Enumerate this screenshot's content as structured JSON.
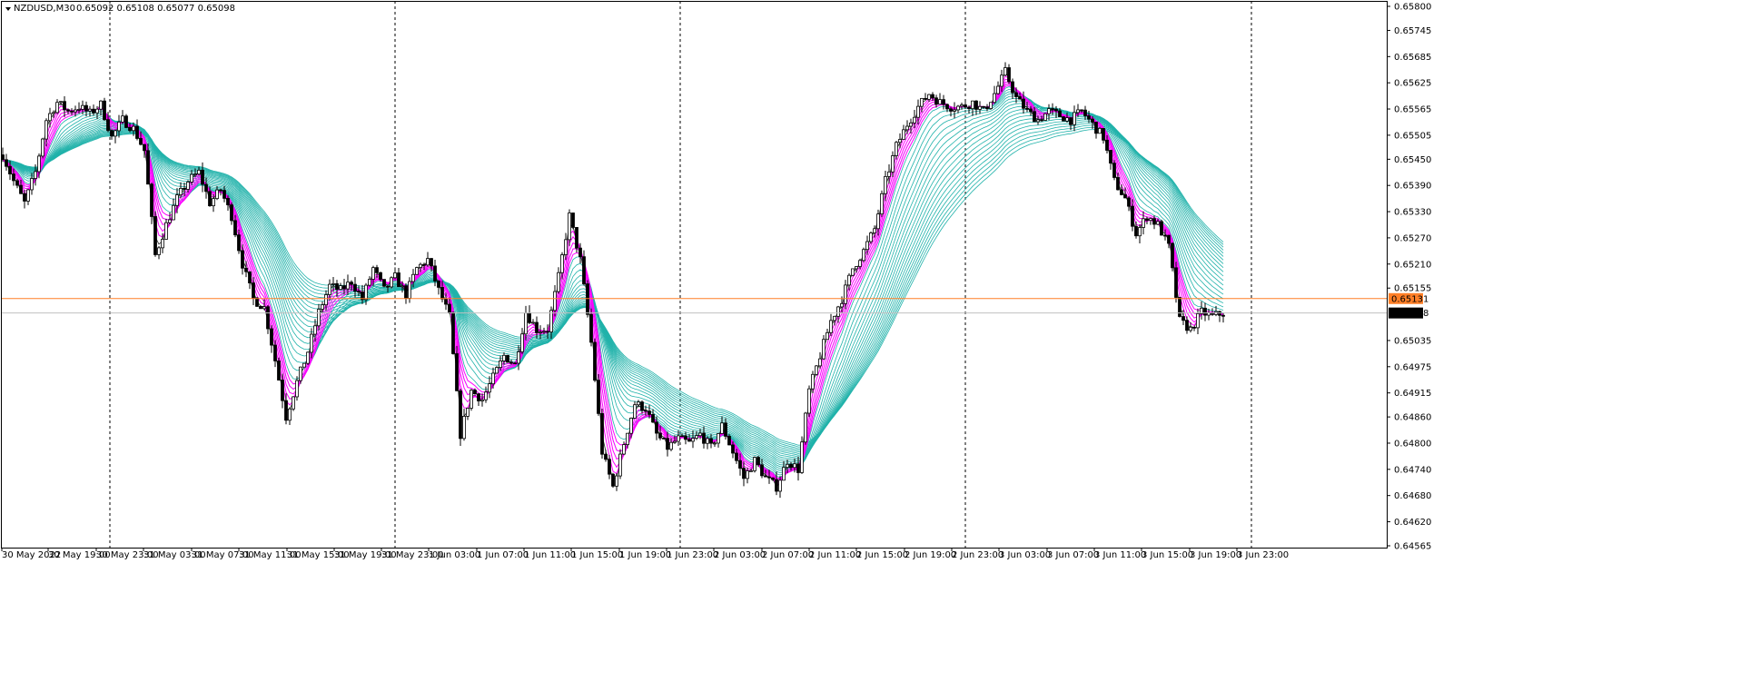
{
  "header": {
    "symbol": "NZDUSD,M30",
    "ohlc": "0.65092 0.65108 0.65077 0.65098",
    "menu_icon": "triangle-down-icon"
  },
  "colors": {
    "background": "#ffffff",
    "frame": "#000000",
    "candle_bull": "#ffffff",
    "candle_bear": "#000000",
    "candle_outline": "#000000",
    "ribbon_slow": "#20b2aa",
    "ribbon_fast": "#ff00ff",
    "line_fast_dark": "#222222",
    "price_line": "#ff7f27",
    "bid_line": "#c0c0c0",
    "separator": "#000000"
  },
  "chart_data": {
    "type": "candlestick",
    "symbol": "NZDUSD",
    "timeframe": "M30",
    "current_bid": 0.65098,
    "marked_level": 0.65131,
    "ylim": [
      0.64565,
      0.658
    ],
    "y_ticks": [
      "0.65800",
      "0.65745",
      "0.65685",
      "0.65625",
      "0.65565",
      "0.65505",
      "0.65450",
      "0.65390",
      "0.65330",
      "0.65270",
      "0.65210",
      "0.65155",
      "0.65131",
      "0.65098",
      "0.65035",
      "0.64975",
      "0.64915",
      "0.64860",
      "0.64800",
      "0.64740",
      "0.64680",
      "0.64620",
      "0.64565"
    ],
    "x_ticks": [
      "30 May 2022",
      "30 May 19:00",
      "30 May 23:00",
      "31 May 03:00",
      "31 May 07:00",
      "31 May 11:00",
      "31 May 15:00",
      "31 May 19:00",
      "31 May 23:00",
      "1 Jun 03:00",
      "1 Jun 07:00",
      "1 Jun 11:00",
      "1 Jun 15:00",
      "1 Jun 19:00",
      "1 Jun 23:00",
      "2 Jun 03:00",
      "2 Jun 07:00",
      "2 Jun 11:00",
      "2 Jun 15:00",
      "2 Jun 19:00",
      "2 Jun 23:00",
      "3 Jun 03:00",
      "3 Jun 07:00",
      "3 Jun 11:00",
      "3 Jun 15:00",
      "3 Jun 19:00",
      "3 Jun 23:00"
    ],
    "day_separators_after": [
      "30 May 23:00",
      "31 May 23:00",
      "1 Jun 23:00",
      "2 Jun 23:00",
      "3 Jun 23:00"
    ],
    "ribbon_fast_periods": 5,
    "ribbon_slow_periods": 20,
    "close_anchors": [
      [
        0,
        0.6546
      ],
      [
        3,
        0.654
      ],
      [
        6,
        0.6535
      ],
      [
        9,
        0.6542
      ],
      [
        12,
        0.6554
      ],
      [
        15,
        0.6558
      ],
      [
        18,
        0.6556
      ],
      [
        21,
        0.6557
      ],
      [
        24,
        0.65555
      ],
      [
        27,
        0.65575
      ],
      [
        30,
        0.655
      ],
      [
        33,
        0.6554
      ],
      [
        36,
        0.6552
      ],
      [
        39,
        0.6547
      ],
      [
        42,
        0.6523
      ],
      [
        45,
        0.653
      ],
      [
        48,
        0.6536
      ],
      [
        51,
        0.654
      ],
      [
        54,
        0.6542
      ],
      [
        57,
        0.6535
      ],
      [
        60,
        0.6538
      ],
      [
        63,
        0.6532
      ],
      [
        66,
        0.6521
      ],
      [
        69,
        0.6513
      ],
      [
        72,
        0.6511
      ],
      [
        75,
        0.6499
      ],
      [
        78,
        0.6486
      ],
      [
        81,
        0.6494
      ],
      [
        84,
        0.6501
      ],
      [
        87,
        0.651
      ],
      [
        90,
        0.6516
      ],
      [
        93,
        0.6515
      ],
      [
        96,
        0.6517
      ],
      [
        99,
        0.6513
      ],
      [
        102,
        0.652
      ],
      [
        105,
        0.6515
      ],
      [
        108,
        0.6518
      ],
      [
        111,
        0.6514
      ],
      [
        114,
        0.652
      ],
      [
        117,
        0.6522
      ],
      [
        120,
        0.6515
      ],
      [
        123,
        0.6509
      ],
      [
        126,
        0.6482
      ],
      [
        129,
        0.6492
      ],
      [
        132,
        0.649
      ],
      [
        135,
        0.6495
      ],
      [
        138,
        0.65
      ],
      [
        141,
        0.6498
      ],
      [
        144,
        0.651
      ],
      [
        147,
        0.6506
      ],
      [
        150,
        0.6506
      ],
      [
        153,
        0.6518
      ],
      [
        156,
        0.6532
      ],
      [
        159,
        0.6522
      ],
      [
        162,
        0.6503
      ],
      [
        165,
        0.6478
      ],
      [
        168,
        0.647
      ],
      [
        171,
        0.648
      ],
      [
        174,
        0.6489
      ],
      [
        177,
        0.6488
      ],
      [
        180,
        0.6482
      ],
      [
        183,
        0.6479
      ],
      [
        186,
        0.6481
      ],
      [
        189,
        0.648
      ],
      [
        192,
        0.6482
      ],
      [
        195,
        0.6479
      ],
      [
        198,
        0.6484
      ],
      [
        201,
        0.6478
      ],
      [
        204,
        0.6472
      ],
      [
        207,
        0.6476
      ],
      [
        210,
        0.6472
      ],
      [
        213,
        0.647
      ],
      [
        216,
        0.6476
      ],
      [
        219,
        0.6474
      ],
      [
        222,
        0.6492
      ],
      [
        225,
        0.65
      ],
      [
        228,
        0.6508
      ],
      [
        231,
        0.6513
      ],
      [
        234,
        0.652
      ],
      [
        237,
        0.6524
      ],
      [
        240,
        0.6529
      ],
      [
        243,
        0.654
      ],
      [
        246,
        0.6548
      ],
      [
        249,
        0.6553
      ],
      [
        252,
        0.6557
      ],
      [
        255,
        0.656
      ],
      [
        258,
        0.6558
      ],
      [
        261,
        0.6557
      ],
      [
        264,
        0.6557
      ],
      [
        267,
        0.6558
      ],
      [
        270,
        0.6556
      ],
      [
        273,
        0.656
      ],
      [
        276,
        0.6565
      ],
      [
        279,
        0.6559
      ],
      [
        282,
        0.6556
      ],
      [
        285,
        0.6554
      ],
      [
        288,
        0.6556
      ],
      [
        291,
        0.6555
      ],
      [
        294,
        0.6554
      ],
      [
        297,
        0.6556
      ],
      [
        300,
        0.6553
      ],
      [
        303,
        0.655
      ],
      [
        306,
        0.654
      ],
      [
        309,
        0.6536
      ],
      [
        312,
        0.6528
      ],
      [
        315,
        0.6532
      ],
      [
        318,
        0.653
      ],
      [
        321,
        0.6525
      ],
      [
        324,
        0.6508
      ],
      [
        327,
        0.6506
      ],
      [
        330,
        0.651
      ],
      [
        333,
        0.6509
      ],
      [
        336,
        0.65098
      ]
    ]
  }
}
